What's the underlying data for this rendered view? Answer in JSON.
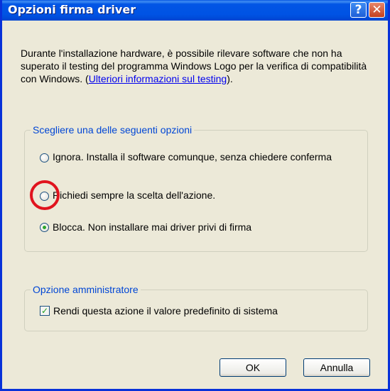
{
  "dialog": {
    "title": "Opzioni firma driver",
    "help_symbol": "?",
    "close_symbol": "✕"
  },
  "intro": {
    "text": "Durante l'installazione hardware, è possibile rilevare software che non ha superato il testing del programma Windows Logo per la verifica di compatibilità con Windows. (",
    "link": "Ulteriori informazioni sul testing",
    "suffix": ")."
  },
  "options_group": {
    "legend": "Scegliere una delle seguenti opzioni",
    "options": [
      {
        "label": "Ignora. Installa il software comunque, senza chiedere conferma",
        "selected": false
      },
      {
        "label": "Richiedi sempre la scelta dell'azione.",
        "selected": false
      },
      {
        "label": "Blocca. Non installare mai driver privi di firma",
        "selected": true
      }
    ]
  },
  "admin_group": {
    "legend": "Opzione amministratore",
    "checkbox_label": "Rendi questa azione il valore predefinito di sistema",
    "checked": true
  },
  "buttons": {
    "ok": "OK",
    "cancel": "Annulla"
  },
  "colors": {
    "title_bar": "#0054e3",
    "legend_text": "#0046d5",
    "link": "#0000ee",
    "annotation_circle": "#e0141e"
  },
  "icons": {
    "help": "help-icon",
    "close": "close-icon",
    "check": "checkmark-icon"
  }
}
